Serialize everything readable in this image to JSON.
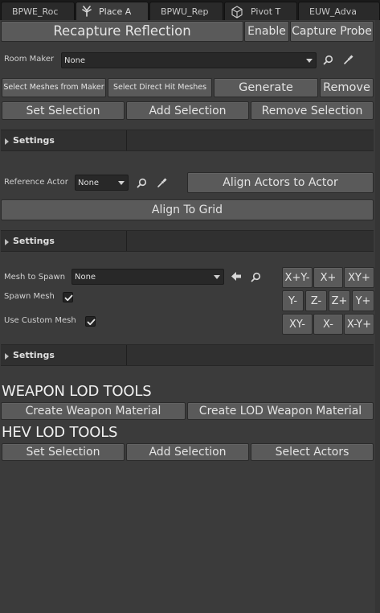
{
  "tabs": [
    {
      "label": "BPWE_Roc",
      "icon": ""
    },
    {
      "label": "Place A",
      "icon": "place-actors-icon"
    },
    {
      "label": "BPWU_Rep",
      "icon": ""
    },
    {
      "label": "Pivot T",
      "icon": "cube-icon"
    },
    {
      "label": "EUW_Adva",
      "icon": ""
    }
  ],
  "reflection": {
    "recapture_label": "Recapture Reflection",
    "enable_label": "Enable",
    "capture_probe_label": "Capture Probe"
  },
  "room_maker": {
    "label": "Room Maker",
    "value": "None"
  },
  "mesh_buttons": {
    "select_from_maker": "Select Meshes from Maker",
    "select_direct_hit": "Select Direct Hit Meshes",
    "generate": "Generate",
    "remove": "Remove",
    "set_selection": "Set Selection",
    "add_selection": "Add Selection",
    "remove_selection": "Remove Selection"
  },
  "settings_1": {
    "title": "Settings"
  },
  "reference_actor": {
    "label": "Reference Actor",
    "value": "None",
    "align_actors_label": "Align Actors to Actor",
    "align_grid_label": "Align To Grid"
  },
  "settings_2": {
    "title": "Settings"
  },
  "spawn": {
    "mesh_label": "Mesh to Spawn",
    "mesh_value": "None",
    "spawn_mesh_label": "Spawn Mesh",
    "spawn_mesh_checked": true,
    "use_custom_label": "Use Custom Mesh",
    "use_custom_checked": true
  },
  "direction_grid": [
    [
      "X+Y-",
      "X+",
      "XY+"
    ],
    [
      "Y-",
      "Z-",
      "Z+",
      "Y+"
    ],
    [
      "XY-",
      "X-",
      "X-Y+"
    ]
  ],
  "settings_3": {
    "title": "Settings"
  },
  "weapon_lod": {
    "title": "WEAPON LOD TOOLS",
    "create_weapon_material": "Create Weapon Material",
    "create_lod_weapon_material": "Create LOD Weapon Material"
  },
  "hev_lod": {
    "title": "HEV LOD TOOLS",
    "set_selection": "Set Selection",
    "add_selection": "Add Selection",
    "select_actors": "Select Actors"
  },
  "colors": {
    "background": "#3b3b3b",
    "button": "#5a5a5a",
    "tab_bar": "#1a1a1a"
  }
}
